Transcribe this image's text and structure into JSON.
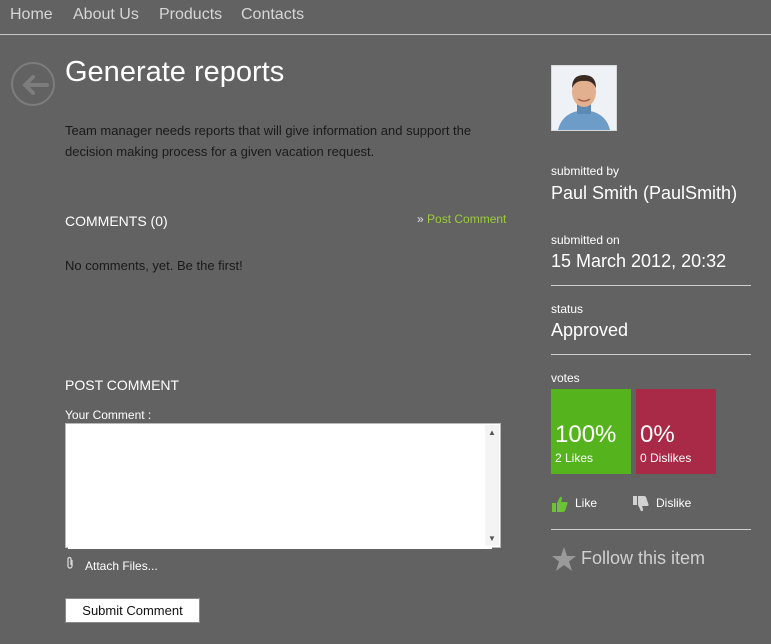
{
  "nav": {
    "items": [
      "Home",
      "About Us",
      "Products",
      "Contacts"
    ]
  },
  "page": {
    "title": "Generate reports",
    "description": "Team manager needs reports that will give information and support the decision making process for a given vacation request."
  },
  "comments": {
    "heading": "COMMENTS (0)",
    "post_link_prefix": "»",
    "post_link": "Post Comment",
    "empty_text": "No comments, yet. Be the first!"
  },
  "post_comment": {
    "heading": "POST COMMENT",
    "label": "Your Comment :",
    "value": "",
    "attach": "Attach Files...",
    "submit": "Submit Comment"
  },
  "sidebar": {
    "submitted_by_label": "submitted by",
    "submitted_by": "Paul Smith (PaulSmith)",
    "submitted_on_label": "submitted on",
    "submitted_on": "15 March 2012, 20:32",
    "status_label": "status",
    "status": "Approved",
    "votes_label": "votes",
    "likes_pct": "100%",
    "likes_count": "2 Likes",
    "dislikes_pct": "0%",
    "dislikes_count": "0 Dislikes",
    "like_label": "Like",
    "dislike_label": "Dislike",
    "follow_label": "Follow this item"
  },
  "colors": {
    "background": "#626262",
    "like_tile": "#55b41e",
    "dislike_tile": "#a82a46",
    "link_green": "#9ccc3c"
  },
  "icons": [
    "back-arrow-icon",
    "avatar-photo",
    "paperclip-icon",
    "thumbs-up-icon",
    "thumbs-down-icon",
    "star-icon",
    "scroll-up-icon",
    "scroll-down-icon"
  ]
}
